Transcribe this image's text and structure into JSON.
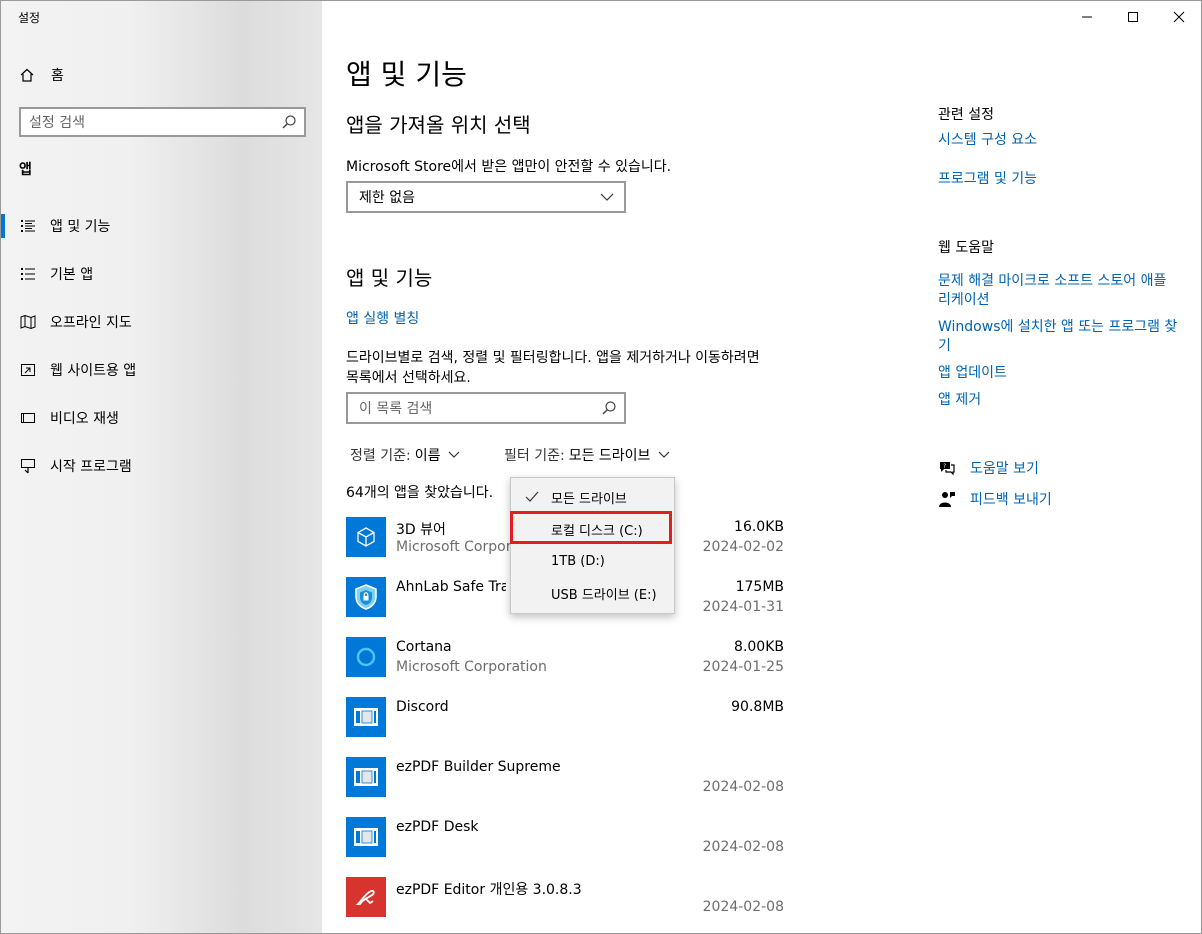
{
  "window": {
    "title": "설정",
    "controls": [
      "minimize-icon",
      "maximize-icon",
      "close-icon"
    ]
  },
  "sidebar": {
    "home_label": "홈",
    "search_placeholder": "설정 검색",
    "section": "앱",
    "items": [
      {
        "label": "앱 및 기능",
        "icon": "apps-features-icon",
        "active": true
      },
      {
        "label": "기본 앱",
        "icon": "default-apps-icon",
        "active": false
      },
      {
        "label": "오프라인 지도",
        "icon": "offline-maps-icon",
        "active": false
      },
      {
        "label": "웹 사이트용 앱",
        "icon": "apps-for-websites-icon",
        "active": false
      },
      {
        "label": "비디오 재생",
        "icon": "video-playback-icon",
        "active": false
      },
      {
        "label": "시작 프로그램",
        "icon": "startup-icon",
        "active": false
      }
    ]
  },
  "main": {
    "page_title": "앱 및 기능",
    "source_heading": "앱을 가져올 위치 선택",
    "source_desc": "Microsoft Store에서 받은 앱만이 안전할 수 있습니다.",
    "source_value": "제한 없음",
    "apps_heading": "앱 및 기능",
    "aliases_link": "앱 실행 별칭",
    "search_desc_1": "드라이브별로 검색, 정렬 및 필터링합니다. 앱을 제거하거나 이동하려면",
    "search_desc_2": "목록에서 선택하세요.",
    "search_placeholder": "이 목록 검색",
    "sort_label": "정렬 기준:",
    "sort_value": "이름",
    "filter_label": "필터 기준:",
    "filter_value": "모든 드라이브",
    "count_text": "64개의 앱을 찾았습니다.",
    "apps": [
      {
        "name": "3D 뷰어",
        "publisher": "Microsoft Corporation",
        "size": "16.0KB",
        "date": "2024-02-02",
        "icon": "3d-viewer-icon"
      },
      {
        "name": "AhnLab Safe Transaction",
        "publisher": "",
        "size": "175MB",
        "date": "2024-01-31",
        "icon": "ahnlab-shield-icon"
      },
      {
        "name": "Cortana",
        "publisher": "Microsoft Corporation",
        "size": "8.00KB",
        "date": "2024-01-25",
        "icon": "cortana-icon"
      },
      {
        "name": "Discord",
        "publisher": "",
        "size": "90.8MB",
        "date": "",
        "icon": "generic-app-icon"
      },
      {
        "name": "ezPDF Builder Supreme",
        "publisher": "",
        "size": "",
        "date": "2024-02-08",
        "icon": "generic-app-icon"
      },
      {
        "name": "ezPDF Desk",
        "publisher": "",
        "size": "",
        "date": "2024-02-08",
        "icon": "generic-app-icon"
      },
      {
        "name": "ezPDF Editor 개인용 3.0.8.3",
        "publisher": "",
        "size": "",
        "date": "2024-02-08",
        "icon": "ezpdf-editor-icon"
      }
    ]
  },
  "filter_dropdown": {
    "options": [
      {
        "label": "모든 드라이브",
        "checked": true
      },
      {
        "label": "로컬 디스크 (C:)",
        "checked": false,
        "highlighted": true
      },
      {
        "label": "1TB (D:)",
        "checked": false
      },
      {
        "label": "USB 드라이브 (E:)",
        "checked": false
      }
    ]
  },
  "right": {
    "related_heading": "관련 설정",
    "related_links": [
      "시스템 구성 요소",
      "프로그램 및 기능"
    ],
    "help_heading": "웹 도움말",
    "help_links": [
      "문제 해결 마이크로 소프트 스토어 애플 리케이션",
      "Windows에 설치한 앱 또는 프로그램 찾기",
      "앱 업데이트",
      "앱 제거"
    ],
    "get_help": "도움말 보기",
    "feedback": "피드백 보내기"
  },
  "colors": {
    "accent": "#0078d7",
    "link": "#0063b1",
    "highlight_border": "#e02020"
  }
}
